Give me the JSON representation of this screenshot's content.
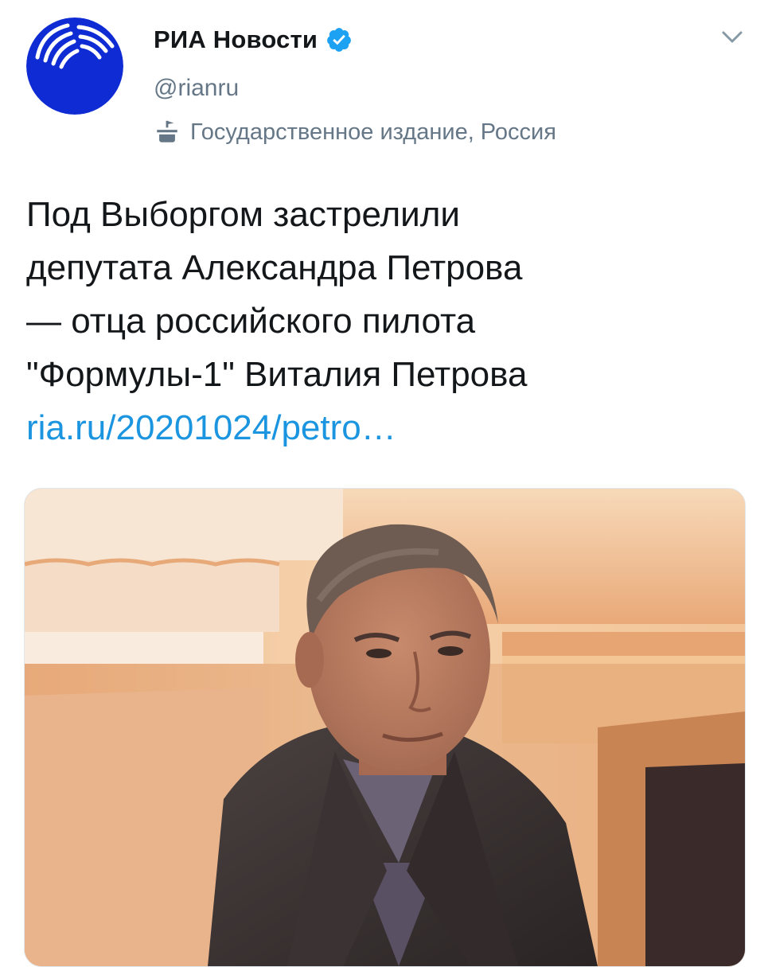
{
  "account": {
    "display_name": "РИА Новости",
    "handle": "@rianru",
    "label": "Государственное издание, Россия",
    "verified": true,
    "avatar_icon": "ria-novosti-logo-icon",
    "label_icon": "government-building-icon"
  },
  "tweet": {
    "lines": [
      "Под Выборгом застрелили",
      "депутата Александра Петрова",
      "— отца российского пилота",
      "\"Формулы-1\" Виталия Петрова"
    ],
    "link": "ria.ru/20201024/petro…"
  },
  "media": {
    "icon": "photo-man-in-suit"
  },
  "colors": {
    "brand_blue": "#0f2cd4",
    "verified_blue": "#1da1f2",
    "link_blue": "#1b95e0",
    "text_primary": "#14171a",
    "text_secondary": "#657786"
  }
}
